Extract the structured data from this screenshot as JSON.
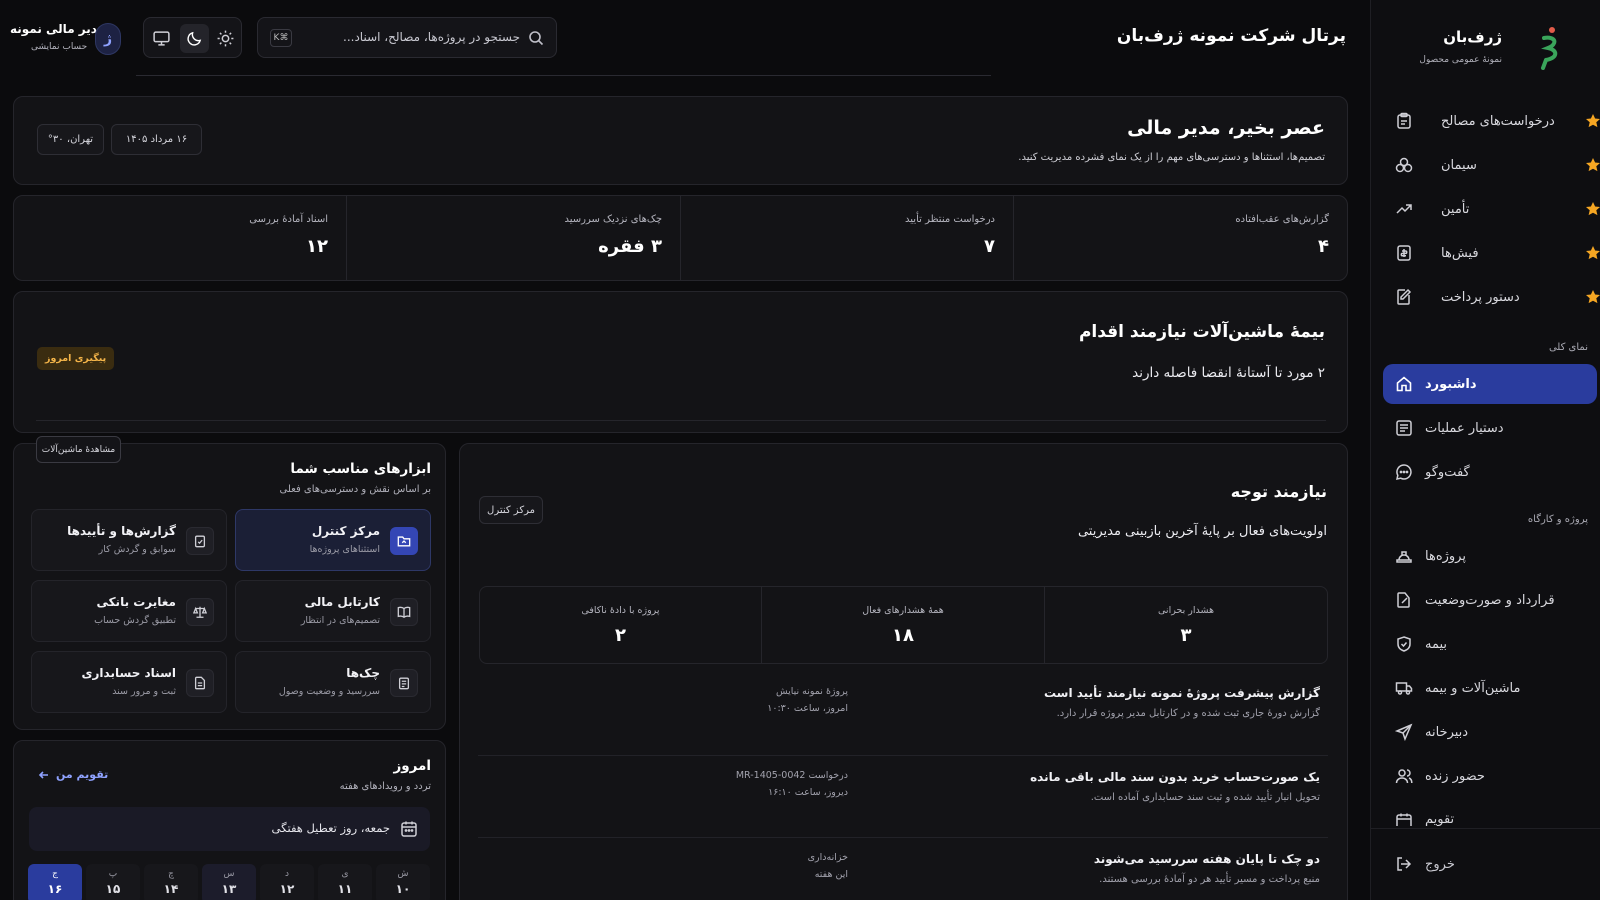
{
  "sidebar": {
    "brand": "ژرف‌بان",
    "brand_sub": "نمونهٔ عمومی محصول",
    "favorites": [
      {
        "label": "درخواست‌های مصالح",
        "icon": "clipboard-icon"
      },
      {
        "label": "سیمان",
        "icon": "cement-icon"
      },
      {
        "label": "تأمین",
        "icon": "trend-up-icon"
      },
      {
        "label": "فیش‌ها",
        "icon": "receipt-icon"
      },
      {
        "label": "دستور پرداخت",
        "icon": "document-edit-icon"
      }
    ],
    "section_overview": "نمای کلی",
    "overview_items": [
      {
        "label": "داشبورد",
        "icon": "home-icon",
        "active": true
      },
      {
        "label": "دستیار عملیات",
        "icon": "list-icon"
      },
      {
        "label": "گفت‌وگو",
        "icon": "chat-icon"
      }
    ],
    "section_projects": "پروژه و کارگاه",
    "project_items": [
      {
        "label": "پروژه‌ها",
        "icon": "hardhat-icon"
      },
      {
        "label": "قرارداد و صورت‌وضعیت",
        "icon": "contract-icon"
      },
      {
        "label": "بیمه",
        "icon": "shield-icon"
      },
      {
        "label": "ماشین‌آلات و بیمه",
        "icon": "truck-icon"
      },
      {
        "label": "دبیرخانه",
        "icon": "send-icon"
      },
      {
        "label": "حضور زنده",
        "icon": "users-icon"
      },
      {
        "label": "تقویم",
        "icon": "calendar-icon"
      }
    ],
    "logout": "خروج"
  },
  "header": {
    "portal_title": "پرتال شرکت نمونه ژرف‌بان",
    "search_placeholder": "جستجو در پروژه‌ها، مصالح، اسناد...",
    "search_shortcut": "K⌘",
    "user_name": "مدیر مالی نمونه",
    "user_role": "حساب نمایشی",
    "avatar_letter": "ژ"
  },
  "greeting": {
    "title": "عصر بخیر، مدیر مالی",
    "subtitle": "تصمیم‌ها، استثناها و دسترسی‌های مهم را از یک نمای فشرده مدیریت کنید.",
    "date_chip": "۱۶ مرداد ۱۴۰۵",
    "weather_chip": "تهران، ۳۰°"
  },
  "stats": [
    {
      "label": "گزارش‌های عقب‌افتاده",
      "value": "۴"
    },
    {
      "label": "درخواست منتظر تأیید",
      "value": "۷"
    },
    {
      "label": "چک‌های نزدیک سررسید",
      "value": "۳ فقره"
    },
    {
      "label": "اسناد آمادهٔ بررسی",
      "value": "۱۲"
    }
  ],
  "alert": {
    "title": "بیمهٔ ماشین‌آلات نیازمند اقدام",
    "body": "۲ مورد تا آستانهٔ انقضا فاصله دارند",
    "badge": "پیگیری امروز",
    "link": "مشاهدهٔ ماشین‌آلات"
  },
  "attention": {
    "title": "نیازمند توجه",
    "subtitle": "اولویت‌های فعال بر پایهٔ آخرین بازبینی مدیریتی",
    "button": "مرکز کنترل",
    "stats": [
      {
        "label": "هشدار بحرانی",
        "value": "۳"
      },
      {
        "label": "همهٔ هشدارهای فعال",
        "value": "۱۸"
      },
      {
        "label": "پروژه با دادهٔ ناکافی",
        "value": "۲"
      }
    ],
    "items": [
      {
        "title": "گزارش پیشرفت پروژهٔ نمونه نیازمند تأیید است",
        "desc": "گزارش دورهٔ جاری ثبت شده و در کارتابل مدیر پروژه قرار دارد.",
        "meta1": "پروژهٔ نمونه نیایش",
        "meta2": "امروز، ساعت ۱۰:۳۰"
      },
      {
        "title": "یک صورت‌حساب خرید بدون سند مالی باقی مانده",
        "desc": "تحویل انبار تأیید شده و ثبت سند حسابداری آماده است.",
        "meta1": "درخواست MR-1405-0042",
        "meta2": "دیروز، ساعت ۱۶:۱۰"
      },
      {
        "title": "دو چک تا پایان هفته سررسید می‌شوند",
        "desc": "منبع پرداخت و مسیر تأیید هر دو آمادهٔ بررسی هستند.",
        "meta1": "خزانه‌داری",
        "meta2": "این هفته"
      }
    ]
  },
  "tools": {
    "title": "ابزارهای مناسب شما",
    "subtitle": "بر اساس نقش و دسترسی‌های فعلی",
    "items": [
      {
        "title": "مرکز کنترل",
        "sub": "استثناهای پروژه‌ها",
        "icon": "folder-icon",
        "selected": true
      },
      {
        "title": "گزارش‌ها و تأییدها",
        "sub": "سوابق و گردش کار",
        "icon": "clipboard-check-icon"
      },
      {
        "title": "کارتابل مالی",
        "sub": "تصمیم‌های در انتظار",
        "icon": "book-icon"
      },
      {
        "title": "مغایرت بانکی",
        "sub": "تطبیق گردش حساب",
        "icon": "scale-icon"
      },
      {
        "title": "چک‌ها",
        "sub": "سررسید و وضعیت وصول",
        "icon": "cheque-icon"
      },
      {
        "title": "اسناد حسابداری",
        "sub": "ثبت و مرور سند",
        "icon": "document-icon"
      }
    ]
  },
  "today": {
    "title": "امروز",
    "subtitle": "تردد و رویدادهای هفته",
    "link": "تقویم من",
    "event": "جمعه، روز تعطیل هفتگی",
    "days": [
      {
        "name": "ش",
        "num": "۱۰"
      },
      {
        "name": "ی",
        "num": "۱۱"
      },
      {
        "name": "د",
        "num": "۱۲"
      },
      {
        "name": "س",
        "num": "۱۳"
      },
      {
        "name": "چ",
        "num": "۱۴"
      },
      {
        "name": "پ",
        "num": "۱۵"
      },
      {
        "name": "ج",
        "num": "۱۶"
      }
    ]
  }
}
